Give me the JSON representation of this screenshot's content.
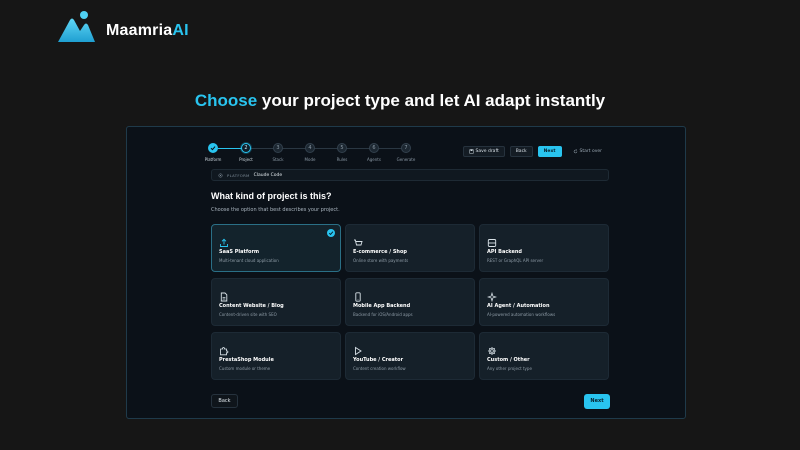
{
  "brand": {
    "name_main": "Maamria",
    "name_accent": "AI"
  },
  "headline": {
    "accent": "Choose",
    "rest": " your project type and let AI adapt instantly"
  },
  "stepper": {
    "steps": [
      {
        "label": "Platform",
        "number": "",
        "state": "done"
      },
      {
        "label": "Project",
        "number": "2",
        "state": "active"
      },
      {
        "label": "Stack",
        "number": "3",
        "state": "todo"
      },
      {
        "label": "Mode",
        "number": "4",
        "state": "todo"
      },
      {
        "label": "Rules",
        "number": "5",
        "state": "todo"
      },
      {
        "label": "Agents",
        "number": "6",
        "state": "todo"
      },
      {
        "label": "Generate",
        "number": "7",
        "state": "todo"
      }
    ]
  },
  "top_actions": {
    "save_draft": "Save draft",
    "back": "Back",
    "next": "Next",
    "start_over": "Start over"
  },
  "platform": {
    "key": "PLATFORM",
    "value": "Claude Code"
  },
  "question": {
    "title": "What kind of project is this?",
    "subtitle": "Choose the option that best describes your project."
  },
  "options": [
    {
      "icon": "upload-icon",
      "title": "SaaS Platform",
      "desc": "Multi-tenant cloud application",
      "selected": true
    },
    {
      "icon": "cart-icon",
      "title": "E-commerce / Shop",
      "desc": "Online store with payments",
      "selected": false
    },
    {
      "icon": "server-icon",
      "title": "API Backend",
      "desc": "REST or GraphQL API server",
      "selected": false
    },
    {
      "icon": "document-icon",
      "title": "Content Website / Blog",
      "desc": "Content-driven site with SEO",
      "selected": false
    },
    {
      "icon": "phone-icon",
      "title": "Mobile App Backend",
      "desc": "Backend for iOS/Android apps",
      "selected": false
    },
    {
      "icon": "sparkle-icon",
      "title": "AI Agent / Automation",
      "desc": "AI-powered automation workflows",
      "selected": false
    },
    {
      "icon": "puzzle-icon",
      "title": "PrestaShop Module",
      "desc": "Custom module or theme",
      "selected": false
    },
    {
      "icon": "play-icon",
      "title": "YouTube / Creator",
      "desc": "Content creation workflow",
      "selected": false
    },
    {
      "icon": "gear-icon",
      "title": "Custom / Other",
      "desc": "Any other project type",
      "selected": false
    }
  ],
  "footer": {
    "back": "Back",
    "next": "Next"
  },
  "colors": {
    "accent": "#29c4ef",
    "background": "#161616",
    "panel": "#0b1118",
    "card": "#152029"
  }
}
